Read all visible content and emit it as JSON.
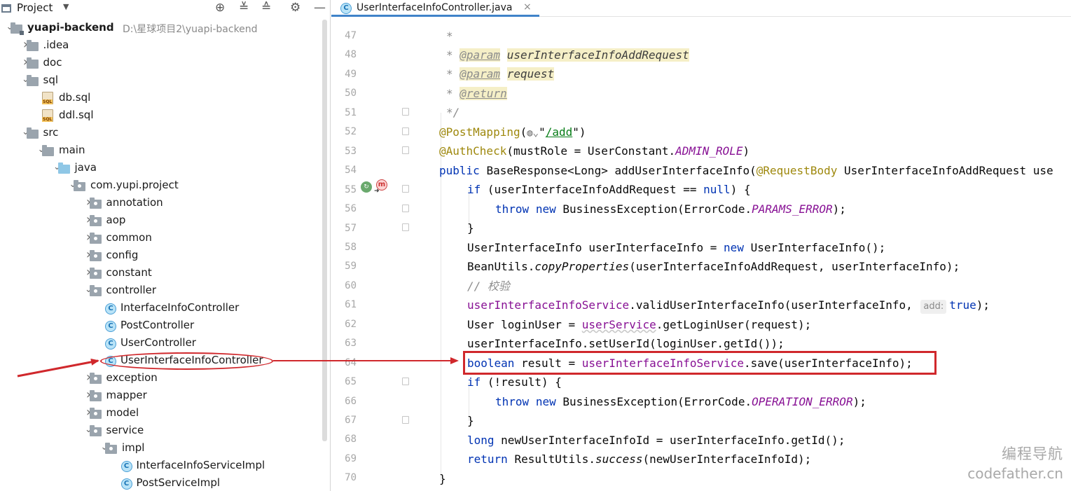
{
  "project_panel": {
    "title": "Project",
    "tree": [
      {
        "label": "yuapi-backend",
        "path": "D:\\星球项目2\\yuapi-backend",
        "type": "module",
        "depth": 0,
        "arrow": "expanded"
      },
      {
        "label": ".idea",
        "type": "folder",
        "depth": 1,
        "arrow": "collapsed"
      },
      {
        "label": "doc",
        "type": "folder",
        "depth": 1,
        "arrow": "collapsed"
      },
      {
        "label": "sql",
        "type": "folder",
        "depth": 1,
        "arrow": "expanded"
      },
      {
        "label": "db.sql",
        "type": "sql",
        "depth": 2,
        "arrow": "none"
      },
      {
        "label": "ddl.sql",
        "type": "sql",
        "depth": 2,
        "arrow": "none"
      },
      {
        "label": "src",
        "type": "folder",
        "depth": 1,
        "arrow": "expanded"
      },
      {
        "label": "main",
        "type": "folder",
        "depth": 2,
        "arrow": "expanded"
      },
      {
        "label": "java",
        "type": "java",
        "depth": 3,
        "arrow": "expanded"
      },
      {
        "label": "com.yupi.project",
        "type": "package",
        "depth": 4,
        "arrow": "expanded"
      },
      {
        "label": "annotation",
        "type": "package",
        "depth": 5,
        "arrow": "collapsed"
      },
      {
        "label": "aop",
        "type": "package",
        "depth": 5,
        "arrow": "collapsed"
      },
      {
        "label": "common",
        "type": "package",
        "depth": 5,
        "arrow": "collapsed"
      },
      {
        "label": "config",
        "type": "package",
        "depth": 5,
        "arrow": "collapsed"
      },
      {
        "label": "constant",
        "type": "package",
        "depth": 5,
        "arrow": "collapsed"
      },
      {
        "label": "controller",
        "type": "package",
        "depth": 5,
        "arrow": "expanded"
      },
      {
        "label": "InterfaceInfoController",
        "type": "class",
        "depth": 6,
        "arrow": "none"
      },
      {
        "label": "PostController",
        "type": "class",
        "depth": 6,
        "arrow": "none"
      },
      {
        "label": "UserController",
        "type": "class",
        "depth": 6,
        "arrow": "none"
      },
      {
        "label": "UserInterfaceInfoController",
        "type": "class",
        "depth": 6,
        "arrow": "none"
      },
      {
        "label": "exception",
        "type": "package",
        "depth": 5,
        "arrow": "collapsed"
      },
      {
        "label": "mapper",
        "type": "package",
        "depth": 5,
        "arrow": "collapsed"
      },
      {
        "label": "model",
        "type": "package",
        "depth": 5,
        "arrow": "collapsed"
      },
      {
        "label": "service",
        "type": "package",
        "depth": 5,
        "arrow": "expanded"
      },
      {
        "label": "impl",
        "type": "package",
        "depth": 6,
        "arrow": "expanded"
      },
      {
        "label": "InterfaceInfoServiceImpl",
        "type": "class",
        "depth": 7,
        "arrow": "none"
      },
      {
        "label": "PostServiceImpl",
        "type": "class",
        "depth": 7,
        "arrow": "none"
      }
    ]
  },
  "editor": {
    "tab": {
      "label": "UserInterfaceInfoController.java",
      "close": "×",
      "icon": "class-icon"
    },
    "line_numbers": [
      "47",
      "48",
      "49",
      "50",
      "51",
      "52",
      "53",
      "54",
      "55",
      "56",
      "57",
      "58",
      "59",
      "60",
      "61",
      "62",
      "63",
      "64",
      "65",
      "66",
      "67",
      "68",
      "69",
      "70"
    ],
    "code": {
      "l47": "*",
      "l48_tag": "@param",
      "l48_arg": "userInterfaceInfoAddRequest",
      "l49_tag": "@param",
      "l49_arg": "request",
      "l50_tag": "@return",
      "l51": "*/",
      "l52_ann": "@PostMapping",
      "l52_path": "/add",
      "l53_ann": "@AuthCheck",
      "l53_a": "(mustRole = UserConstant.",
      "l53_const": "ADMIN_ROLE",
      "l53_b": ")",
      "l54_kw": "public",
      "l54_a": "BaseResponse<Long> addUserInterfaceInfo(",
      "l54_ann": "@RequestBody",
      "l54_b": "UserInterfaceInfoAddRequest use",
      "l55_kw": "if",
      "l55_a": "(userInterfaceInfoAddRequest == ",
      "l55_null": "null",
      "l55_b": ") {",
      "l56_kw1": "throw",
      "l56_kw2": "new",
      "l56_a": "BusinessException(ErrorCode.",
      "l56_const": "PARAMS_ERROR",
      "l56_b": ");",
      "l57": "}",
      "l58_a": "UserInterfaceInfo userInterfaceInfo = ",
      "l58_kw": "new",
      "l58_b": "UserInterfaceInfo();",
      "l59_a": "BeanUtils.",
      "l59_m": "copyProperties",
      "l59_b": "(userInterfaceInfoAddRequest, userInterfaceInfo);",
      "l60": "// 校验",
      "l61_fld": "userInterfaceInfoService",
      "l61_a": ".validUserInterfaceInfo(userInterfaceInfo,",
      "l61_hint": "add:",
      "l61_kw": "true",
      "l61_b": ");",
      "l62_a": "User loginUser = ",
      "l62_fld": "userService",
      "l62_b": ".getLoginUser(request);",
      "l63": "userInterfaceInfo.setUserId(loginUser.getId());",
      "l64_kw": "boolean",
      "l64_a": "result = ",
      "l64_fld": "userInterfaceInfoService",
      "l64_b": ".save(userInterfaceInfo);",
      "l65_kw": "if",
      "l65_a": "(!result) {",
      "l66_kw1": "throw",
      "l66_kw2": "new",
      "l66_a": "BusinessException(ErrorCode.",
      "l66_const": "OPERATION_ERROR",
      "l66_b": ");",
      "l67": "}",
      "l68_kw": "long",
      "l68_a": "newUserInterfaceInfoId = userInterfaceInfo.getId();",
      "l69_kw": "return",
      "l69_a": "ResultUtils.",
      "l69_m": "success",
      "l69_b": "(newUserInterfaceInfoId);",
      "l70": "}"
    }
  },
  "watermark": {
    "cn": "编程导航",
    "en": "codefather.cn"
  },
  "colors": {
    "annotation_red": "#d0282c",
    "tab_underline": "#4083c9",
    "keyword": "#0033b3",
    "field": "#871094"
  }
}
